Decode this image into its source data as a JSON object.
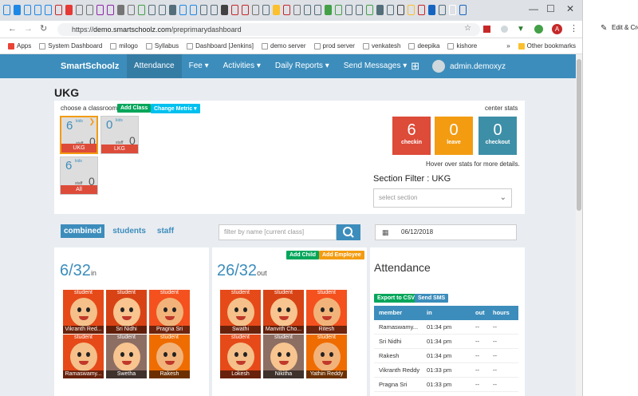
{
  "browser": {
    "url_scheme": "https://",
    "url_host": "demo.smartschoolz.com",
    "url_path": "/preprimarydashboard",
    "bookmarks": [
      "Apps",
      "System Dashboard",
      "milogo",
      "Syllabus",
      "Dashboard [Jenkins]",
      "demo server",
      "prod server",
      "venkatesh",
      "deepika",
      "kishore"
    ],
    "overflow": "»",
    "other_bookmarks": "Other bookmarks",
    "profile_initial": "A",
    "side_item": "Edit & Cre"
  },
  "nav": {
    "brand": "SmartSchoolz",
    "items": [
      "Attendance",
      "Fee ▾",
      "Activities ▾",
      "Daily Reports ▾",
      "Send Messages ▾"
    ],
    "user": "admin.demoxyz",
    "colors": {
      "bar": "#3c8dbc",
      "active": "#357ca5"
    }
  },
  "classroom": {
    "title": "UKG",
    "choose_label": "choose a classroom",
    "add_class": "Add Class",
    "change_metric": "Change Metric ▾",
    "kids_label": "kids",
    "staff_label": "staff",
    "cards": [
      {
        "kids": "6",
        "staff": "0",
        "label": "UKG"
      },
      {
        "kids": "0",
        "staff": "0",
        "label": "LKG"
      },
      {
        "kids": "6",
        "staff": "0",
        "label": "All"
      }
    ]
  },
  "stats": {
    "title": "center stats",
    "items": [
      {
        "value": "6",
        "label": "checkin",
        "color": "#dd4b39"
      },
      {
        "value": "0",
        "label": "leave",
        "color": "#f39c12"
      },
      {
        "value": "0",
        "label": "checkout",
        "color": "#3d8fa8"
      }
    ],
    "hover_hint": "Hover over stats for more details.",
    "section_filter": "Section Filter : UKG",
    "select_placeholder": "select section"
  },
  "tabs": [
    "combined",
    "students",
    "staff"
  ],
  "filter_placeholder": "filter by name [current class]",
  "date": "06/12/2018",
  "in_panel": {
    "count": "6/32",
    "suffix": "in",
    "kids": [
      {
        "role": "student",
        "name": "Vikranth Red..."
      },
      {
        "role": "student",
        "name": "Sri Nidhi"
      },
      {
        "role": "student",
        "name": "Pragna Sri"
      },
      {
        "role": "student",
        "name": "Ramaswamy..."
      },
      {
        "role": "student",
        "name": "Swetha"
      },
      {
        "role": "student",
        "name": "Rakesh"
      }
    ]
  },
  "out_panel": {
    "count": "26/32",
    "suffix": "out",
    "add_child": "Add Child",
    "add_employee": "Add Employee",
    "kids": [
      {
        "role": "student",
        "name": "Swathi"
      },
      {
        "role": "student",
        "name": "Manvith Cho..."
      },
      {
        "role": "student",
        "name": "Ritesh"
      },
      {
        "role": "student",
        "name": "Lokesh"
      },
      {
        "role": "student",
        "name": "Nikitha"
      },
      {
        "role": "student",
        "name": "Yathin Reddy"
      }
    ]
  },
  "attendance": {
    "title": "Attendance",
    "export": "Export to CSV",
    "send_sms": "Send SMS",
    "headers": [
      "member",
      "in",
      "out",
      "hours"
    ],
    "rows": [
      [
        "Ramaswamy...",
        "01:34 pm",
        "--",
        "--"
      ],
      [
        "Sri Nidhi",
        "01:34 pm",
        "--",
        "--"
      ],
      [
        "Rakesh",
        "01:34 pm",
        "--",
        "--"
      ],
      [
        "Vikranth Reddy",
        "01:33 pm",
        "--",
        "--"
      ],
      [
        "Pragna Sri",
        "01:33 pm",
        "--",
        "--"
      ]
    ]
  }
}
